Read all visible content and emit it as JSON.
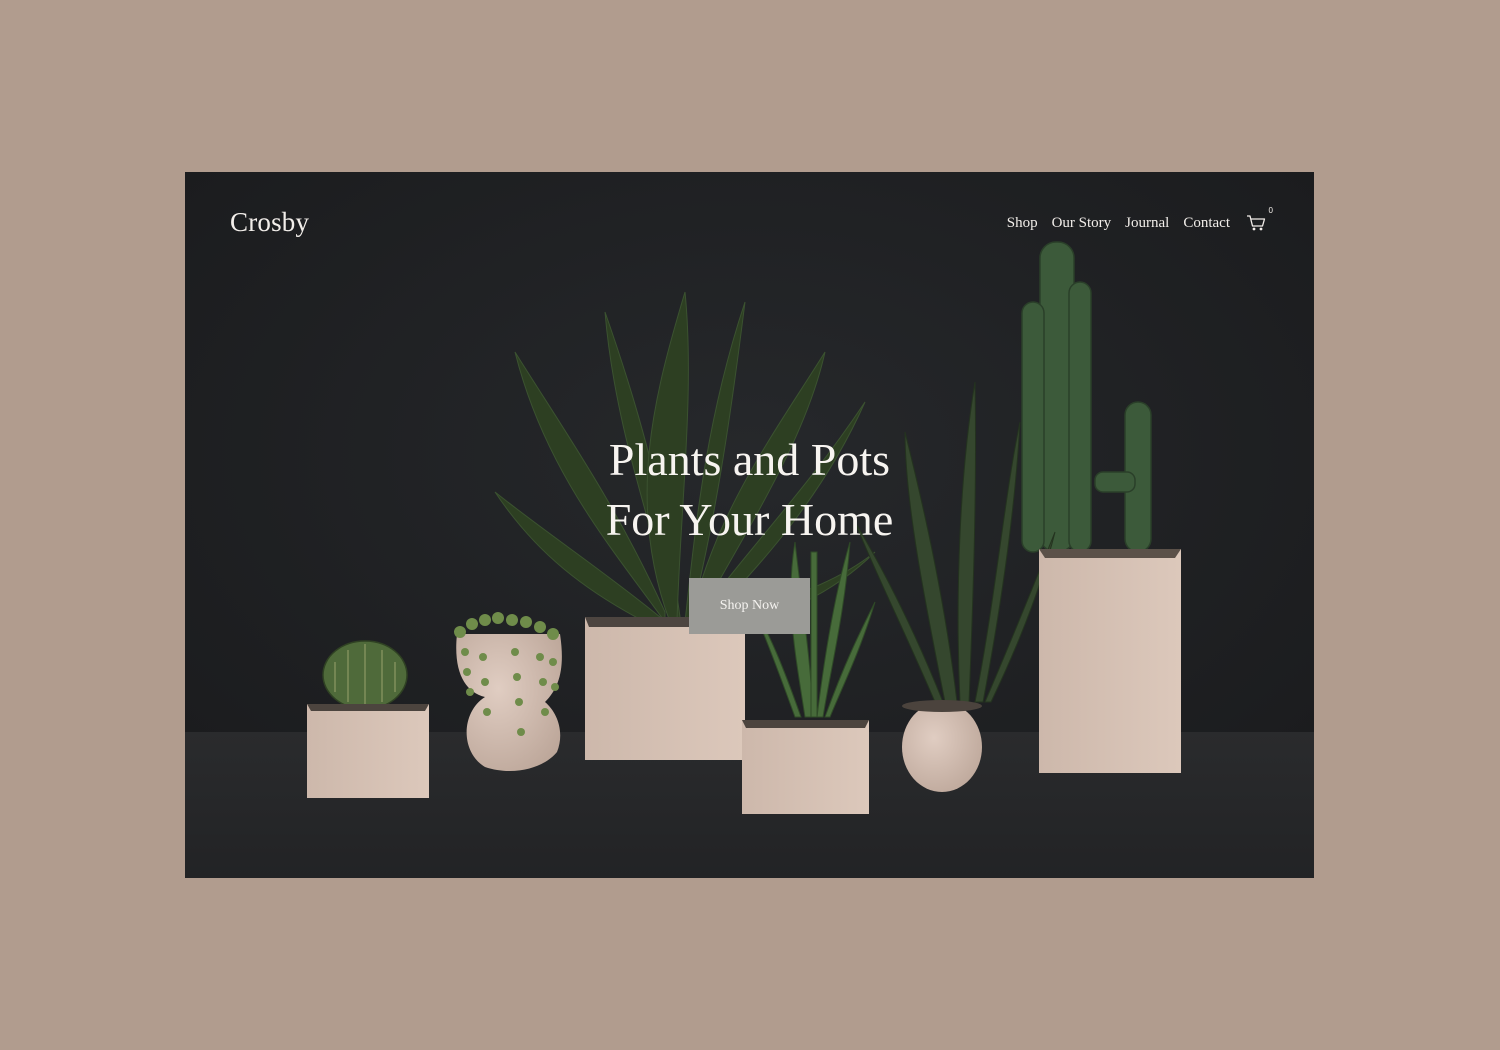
{
  "site": {
    "logo": "Crosby",
    "nav": [
      {
        "label": "Shop"
      },
      {
        "label": "Our Story"
      },
      {
        "label": "Journal"
      },
      {
        "label": "Contact"
      }
    ],
    "cart_count": "0"
  },
  "hero": {
    "headline_line1": "Plants and Pots",
    "headline_line2": "For Your Home",
    "cta_label": "Shop Now"
  },
  "colors": {
    "page_background": "#b19c8e",
    "hero_background": "#1e1f21",
    "pot_color": "#d8c4b8",
    "button_color": "#9b9b97",
    "text_light": "#f2eeea"
  },
  "icons": {
    "cart": "cart-icon"
  }
}
